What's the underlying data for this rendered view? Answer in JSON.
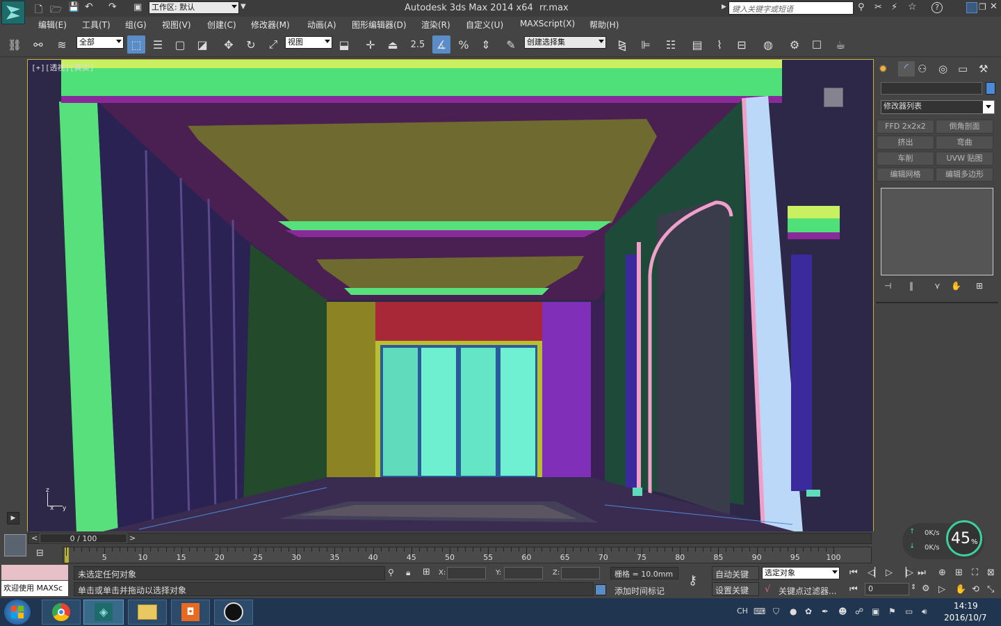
{
  "titlebar": {
    "workspace_label": "工作区: 默认",
    "app_title": "Autodesk 3ds Max  2014 x64",
    "file_name": "rr.max",
    "search_placeholder": "键入关键字或短语",
    "help_label": "?"
  },
  "menubar": {
    "items": [
      "编辑(E)",
      "工具(T)",
      "组(G)",
      "视图(V)",
      "创建(C)",
      "修改器(M)",
      "动画(A)",
      "图形编辑器(D)",
      "渲染(R)",
      "自定义(U)",
      "MAXScript(X)",
      "帮助(H)"
    ]
  },
  "toolbar": {
    "selection_filter": "全部",
    "ref_coord": "视图",
    "snap_label": "2.5",
    "angle_label": "%",
    "named_selection": "创建选择集"
  },
  "viewport": {
    "label": "[+][透视][真实]",
    "axis_z": "z",
    "axis_x": "x",
    "axis_y": "y"
  },
  "cmdpanel": {
    "modifier_list": "修改器列表",
    "buttons": [
      "FFD 2x2x2",
      "倒角剖面",
      "挤出",
      "弯曲",
      "车削",
      "UVW 贴图",
      "编辑网格",
      "编辑多边形"
    ],
    "accent": "#4a8ad8"
  },
  "timeline": {
    "frame_label": "0 / 100",
    "prev": "<",
    "next": ">",
    "ticks": [
      "5",
      "10",
      "15",
      "20",
      "25",
      "30",
      "35",
      "40",
      "45",
      "50",
      "55",
      "60",
      "65",
      "70",
      "75",
      "80",
      "85",
      "90",
      "95",
      "100"
    ]
  },
  "status": {
    "welcome": "欢迎使用 MAXSc",
    "selection_status": "未选定任何对象",
    "prompt": "单击或单击并拖动以选择对象",
    "x_label": "X:",
    "y_label": "Y:",
    "z_label": "Z:",
    "grid": "栅格 = 10.0mm",
    "add_time_tag": "添加时间标记",
    "auto_key": "自动关键点",
    "set_key": "设置关键点",
    "key_target": "选定对象",
    "key_filters": "关键点过滤器...",
    "frame_value": "0"
  },
  "netmeter": {
    "up": "0K/s",
    "down": "0K/s",
    "percent": "45",
    "percent_unit": "%"
  },
  "taskbar": {
    "lang": "CH",
    "time": "14:19",
    "date": "2016/10/7"
  }
}
